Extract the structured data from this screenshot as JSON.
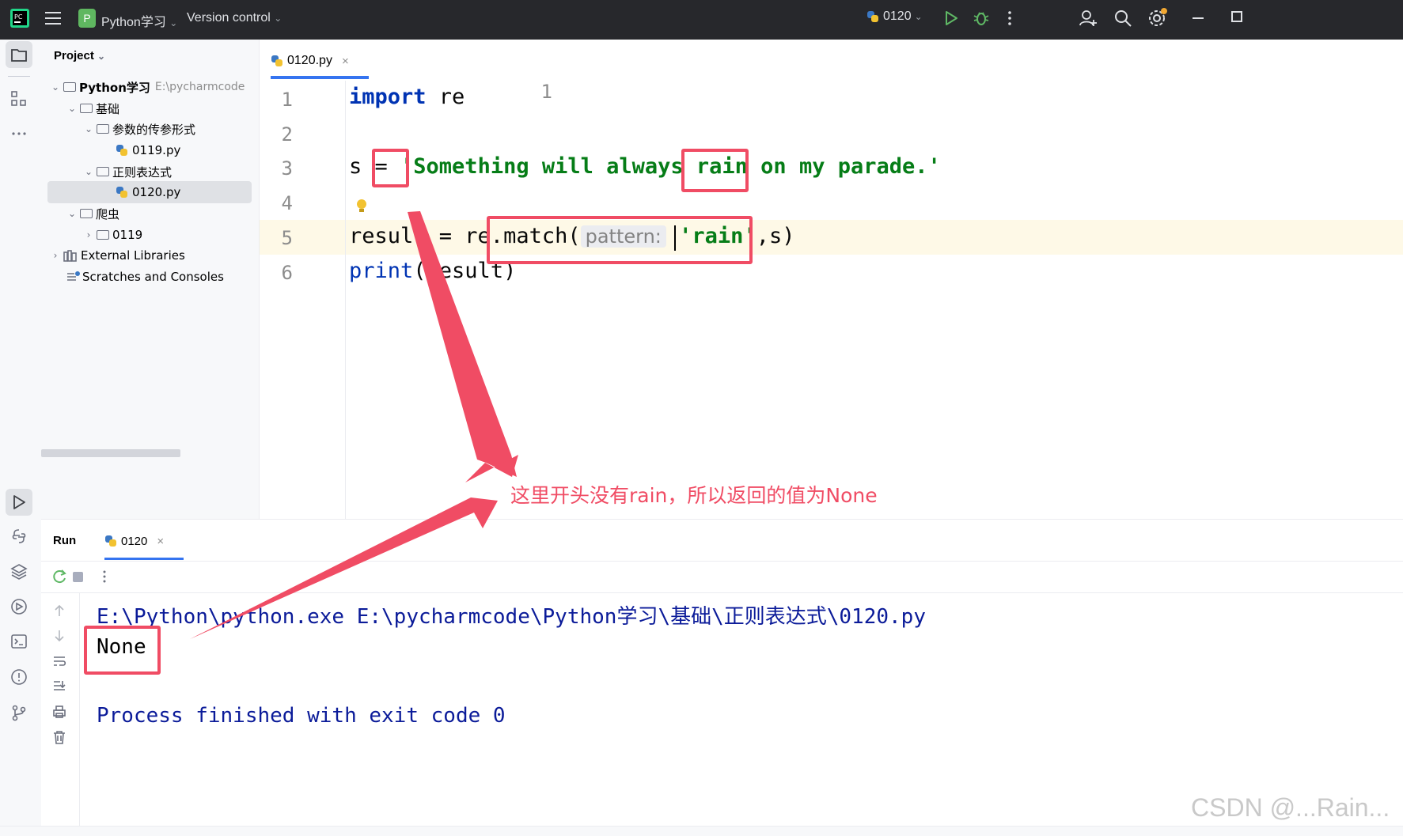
{
  "titlebar": {
    "project_badge": "P",
    "project_name": "Python学习",
    "vcs": "Version control",
    "run_config": "0120"
  },
  "project_panel": {
    "title": "Project",
    "tree": [
      {
        "label": "Python学习",
        "hint": "E:\\pycharmcode",
        "type": "folder",
        "expanded": true
      },
      {
        "label": "基础",
        "type": "folder",
        "expanded": true
      },
      {
        "label": "参数的传参形式",
        "type": "folder",
        "expanded": true
      },
      {
        "label": "0119.py",
        "type": "python-file"
      },
      {
        "label": "正则表达式",
        "type": "folder",
        "expanded": true
      },
      {
        "label": "0120.py",
        "type": "python-file",
        "selected": true
      },
      {
        "label": "爬虫",
        "type": "folder",
        "expanded": true
      },
      {
        "label": "0119",
        "type": "folder",
        "expanded": false
      },
      {
        "label": "External Libraries",
        "type": "library",
        "expanded": false
      },
      {
        "label": "Scratches and Consoles",
        "type": "scratches"
      }
    ]
  },
  "editor": {
    "tab": "0120.py",
    "lines": [
      {
        "num": "1"
      },
      {
        "num": "2"
      },
      {
        "num": "3"
      },
      {
        "num": "4"
      },
      {
        "num": "5"
      },
      {
        "num": "6"
      }
    ],
    "code": {
      "l1_kw": "import",
      "l1_rest": " re",
      "l3_a": "s = ",
      "l3_str": "'Something will always rain on my parade.'",
      "l5_a": "result = re.match(",
      "l5_hint": "pattern:",
      "l5_str": "'rain'",
      "l5_b": ",s)",
      "l6_fn": "print",
      "l6_rest": "(result)"
    }
  },
  "annotation": {
    "text": "这里开头没有rain，所以返回的值为None",
    "color": "#f04c64"
  },
  "run_panel": {
    "title": "Run",
    "tab": "0120",
    "output": [
      "E:\\Python\\python.exe E:\\pycharmcode\\Python学习\\基础\\正则表达式\\0120.py",
      "None",
      "",
      "Process finished with exit code 0"
    ]
  },
  "watermark": "CSDN @...Rain..."
}
